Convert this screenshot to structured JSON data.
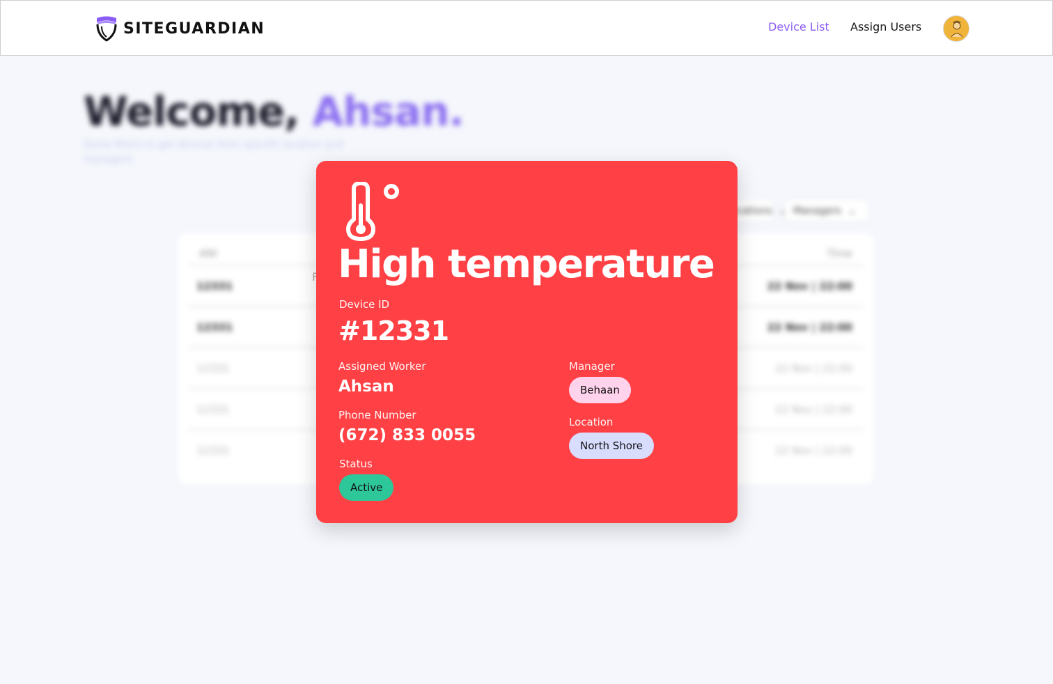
{
  "header": {
    "brand": "SITEGUARDIAN",
    "nav": {
      "device_list": "Device List",
      "assign_users": "Assign Users"
    },
    "active_nav": "device_list",
    "accent_color": "#8b5cf6"
  },
  "welcome": {
    "greeting": "Welcome,",
    "user_name": "Ahsan.",
    "subtitle": "Some filters to get devices from specific location and managers"
  },
  "filters": {
    "locations_label": "Locations",
    "managers_label": "Managers"
  },
  "table": {
    "col_id": "ANI",
    "col_time": "Time",
    "ghost_letter": "F",
    "rows": [
      {
        "id": "12331",
        "time": "22 Nov | 22:00"
      },
      {
        "id": "12331",
        "time": "22 Nov | 22:00"
      },
      {
        "id": "12331",
        "time": "22 Nov | 22:00"
      },
      {
        "id": "12331",
        "time": "22 Nov | 22:00"
      },
      {
        "id": "12331",
        "time": "22 Nov | 22:00"
      }
    ]
  },
  "alert": {
    "icon": "thermometer-icon",
    "title": "High temperature",
    "background_color": "#ff4044",
    "device_id_label": "Device ID",
    "device_id": "#12331",
    "worker_label": "Assigned Worker",
    "worker": "Ahsan",
    "phone_label": "Phone Number",
    "phone": "(672) 833 0055",
    "status_label": "Status",
    "status": "Active",
    "manager_label": "Manager",
    "manager": "Behaan",
    "location_label": "Location",
    "location": "North Shore"
  }
}
